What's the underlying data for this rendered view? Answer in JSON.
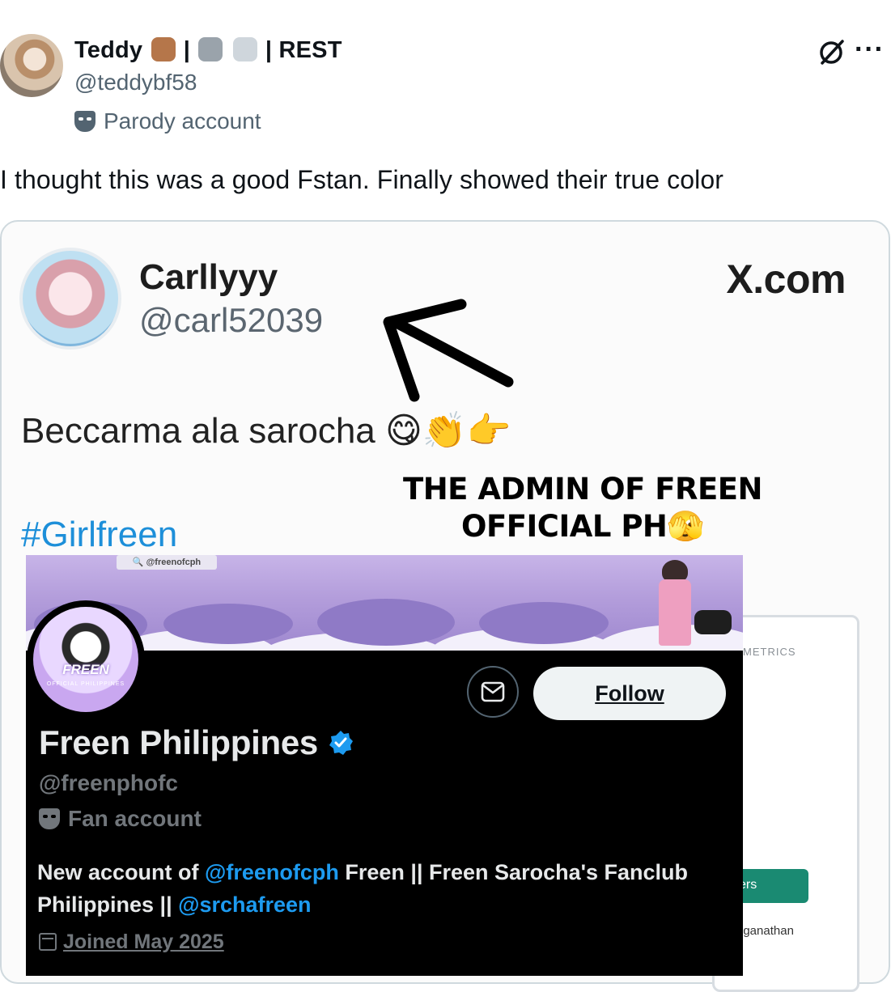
{
  "post": {
    "display_name_prefix": "Teddy",
    "display_name_sep1": "|",
    "display_name_sep2": "| REST",
    "handle": "@teddybf58",
    "account_label": "Parody account",
    "text": "I thought this was a good Fstan. Finally showed their true color",
    "more_glyph": "···"
  },
  "quoted": {
    "name": "Carllyyy",
    "handle": "@carl52039",
    "source": "X.com",
    "text": "Beccarma ala sarocha 😋👏👉",
    "hashtag": "#Girlfreen"
  },
  "caption": {
    "line1": "THE ADMIN OF FREEN",
    "line2": "OFFICIAL PH🫣"
  },
  "profile": {
    "banner_tag": "🔍 @freenofcph",
    "avatar_word": "FREEN",
    "avatar_sub": "OFFICIAL PHILIPPINES",
    "follow_label": "Follow",
    "name": "Freen Philippines",
    "handle": "@freenphofc",
    "account_label": "Fan account",
    "bio_1": "New account of ",
    "bio_link1": "@freenofcph",
    "bio_2": " Freen || Freen Sarocha's Fanclub Philippines || ",
    "bio_link2": "@srchafreen",
    "joined": "Joined May 2025"
  },
  "metrics_card": {
    "label": "METRICS",
    "button": "ers",
    "name_fragment": "nganathan"
  },
  "colors": {
    "link_blue": "#1d9bf0",
    "hashtag_blue": "#1d8fd9",
    "banner_purple": "#b39ddb",
    "metrics_green": "#1a8a72"
  },
  "icons": [
    "parody-mask-icon",
    "grok-icon",
    "more-icon",
    "message-icon",
    "verified-badge-icon",
    "calendar-icon",
    "arrow-annotation"
  ]
}
